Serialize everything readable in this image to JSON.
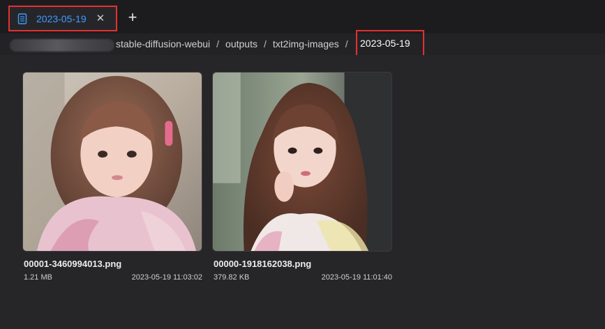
{
  "tab": {
    "label": "2023-05-19",
    "icon": "document-icon",
    "close_icon": "close-icon",
    "accent": "#3f9bff",
    "highlight": "#e5302f"
  },
  "new_tab_icon": "plus-icon",
  "breadcrumb": {
    "items": [
      "stable-diffusion-webui",
      "outputs",
      "txt2img-images"
    ],
    "separator": "/",
    "current": "2023-05-19"
  },
  "files": [
    {
      "name": "00001-3460994013.png",
      "size": "1.21 MB",
      "modified": "2023-05-19 11:03:02"
    },
    {
      "name": "00000-1918162038.png",
      "size": "379.82 KB",
      "modified": "2023-05-19 11:01:40"
    }
  ]
}
